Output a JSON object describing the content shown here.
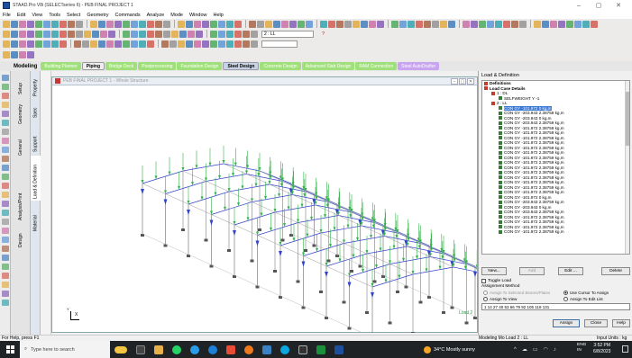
{
  "window": {
    "title": "STAAD.Pro V8i (SELECTseries 6) - PEB FINAL PROJECT 1",
    "controls": [
      "–",
      "▢",
      "✕"
    ]
  },
  "menu": [
    "File",
    "Edit",
    "View",
    "Tools",
    "Select",
    "Geometry",
    "Commands",
    "Analyze",
    "Mode",
    "Window",
    "Help"
  ],
  "toolbar": {
    "combo_load": "2 : LL",
    "zoom_combo": "",
    "accent": "#2fa84f"
  },
  "mode_tabs": {
    "modeling_label": "Modeling",
    "tabs": [
      "Building Planner",
      "Piping",
      "Bridge Deck",
      "Postprocessing",
      "Foundation Design",
      "Steel Design",
      "Concrete Design",
      "Advanced Slab Design",
      "RAM Connection",
      "Steel AutoDrafter"
    ]
  },
  "page_tabs": [
    "Setup",
    "Geometry",
    "General",
    "Analysis/Print",
    "Design"
  ],
  "page_subtabs": [
    "Property",
    "Spec",
    "Support",
    "Load & Definition",
    "Material"
  ],
  "viewport": {
    "title": "PEB FINAL PROJECT 1 - Whole Structure",
    "load_label": "Load 2",
    "axis_x": "X",
    "axis_y": "Y",
    "axis_z": "Z"
  },
  "panel": {
    "title": "Load & Definition",
    "tree": [
      {
        "text": "Definitions",
        "level": 1,
        "kind": "folder",
        "bold": true
      },
      {
        "text": "Load Case Details",
        "level": 1,
        "kind": "folder",
        "bold": true
      },
      {
        "text": "1 : DL",
        "level": 2,
        "kind": "case"
      },
      {
        "text": "SELFWEIGHT Y -1",
        "level": 3,
        "kind": "item"
      },
      {
        "text": "2 : LL",
        "level": 2,
        "kind": "case"
      },
      {
        "text": "CON GY -101.972 0 kg,m",
        "level": 3,
        "kind": "item",
        "selected": true
      },
      {
        "text": "CON GY -203.943 2.38759 kg,m",
        "level": 3,
        "kind": "item"
      },
      {
        "text": "CON GY -203.943 0 kg,m",
        "level": 3,
        "kind": "item"
      },
      {
        "text": "CON GY -203.943 2.38759 kg,m",
        "level": 3,
        "kind": "item"
      },
      {
        "text": "CON GY -101.972 2.38759 kg,m",
        "level": 3,
        "kind": "item"
      },
      {
        "text": "CON GY -101.972 2.38759 kg,m",
        "level": 3,
        "kind": "item"
      },
      {
        "text": "CON GY -101.972 2.38759 kg,m",
        "level": 3,
        "kind": "item"
      },
      {
        "text": "CON GY -101.972 2.38759 kg,m",
        "level": 3,
        "kind": "item"
      },
      {
        "text": "CON GY -101.972 2.38759 kg,m",
        "level": 3,
        "kind": "item"
      },
      {
        "text": "CON GY -101.972 2.38759 kg,m",
        "level": 3,
        "kind": "item"
      },
      {
        "text": "CON GY -101.972 2.38759 kg,m",
        "level": 3,
        "kind": "item"
      },
      {
        "text": "CON GY -101.972 2.38759 kg,m",
        "level": 3,
        "kind": "item"
      },
      {
        "text": "CON GY -101.972 2.38759 kg,m",
        "level": 3,
        "kind": "item"
      },
      {
        "text": "CON GY -101.972 2.38759 kg,m",
        "level": 3,
        "kind": "item"
      },
      {
        "text": "CON GY -101.972 2.38759 kg,m",
        "level": 3,
        "kind": "item"
      },
      {
        "text": "CON GY -101.972 2.38759 kg,m",
        "level": 3,
        "kind": "item"
      },
      {
        "text": "CON GY -101.972 2.38759 kg,m",
        "level": 3,
        "kind": "item"
      },
      {
        "text": "CON GY -101.972 2.38759 kg,m",
        "level": 3,
        "kind": "item"
      },
      {
        "text": "CON GY -101.972 0 kg,m",
        "level": 3,
        "kind": "item"
      },
      {
        "text": "CON GY -203.943 2.38759 kg,m",
        "level": 3,
        "kind": "item"
      },
      {
        "text": "CON GY -203.943 0 kg,m",
        "level": 3,
        "kind": "item"
      },
      {
        "text": "CON GY -203.943 2.38759 kg,m",
        "level": 3,
        "kind": "item"
      },
      {
        "text": "CON GY -101.972 2.38759 kg,m",
        "level": 3,
        "kind": "item"
      },
      {
        "text": "CON GY -101.972 2.38759 kg,m",
        "level": 3,
        "kind": "item"
      },
      {
        "text": "CON GY -101.972 2.38759 kg,m",
        "level": 3,
        "kind": "item"
      },
      {
        "text": "CON GY -101.972 2.38759 kg,m",
        "level": 3,
        "kind": "item"
      }
    ],
    "buttons": {
      "new": "New...",
      "add": "Add",
      "edit": "Edit ...",
      "delete": "Delete"
    },
    "toggle_load": "Toggle Load",
    "assignment_method": "Assignment Method",
    "assign_selected": "Assign To Selected Beams/Plates",
    "use_cursor": "Use Cursor To Assign",
    "assign_view": "Assign To View",
    "assign_edit_list": "Assign To Edit List",
    "edit_list_value": "1 14 27 40 53 66 79 92 105 118 131",
    "assign": "Assign",
    "close": "Close",
    "help": "Help"
  },
  "status": {
    "left": "For Help, press F1",
    "mid": "Modeling Mo  Load 2 : LL",
    "right": "Input Units : kg"
  },
  "taskbar": {
    "search_placeholder": "Type here to search",
    "weather": "34°C  Mostly sunny",
    "lang": "ENG",
    "region": "IN",
    "time": "3:52 PM",
    "date": "6/8/2023"
  }
}
